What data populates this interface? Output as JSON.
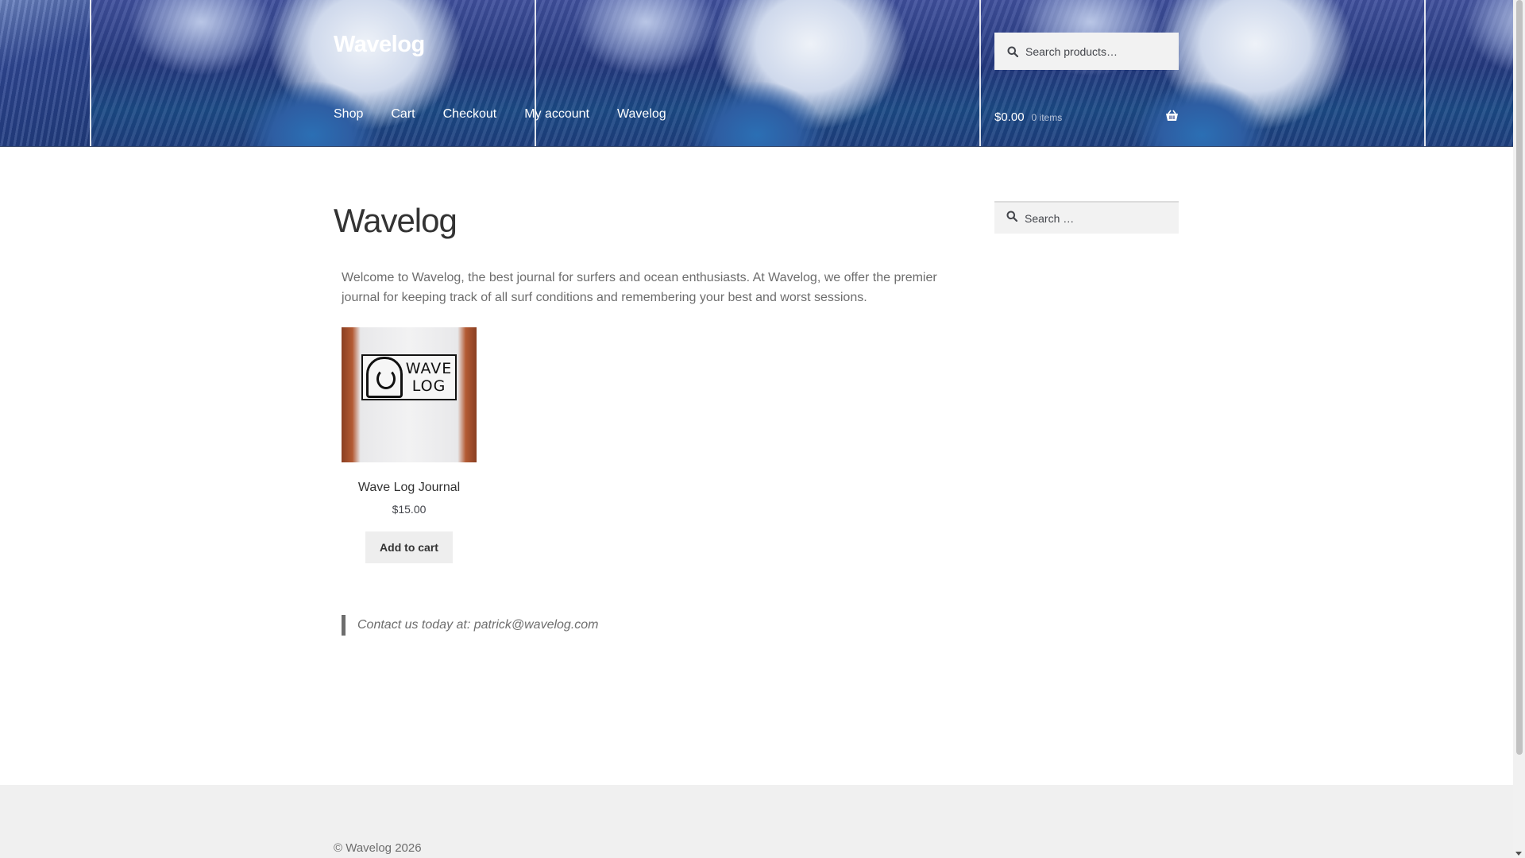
{
  "header": {
    "site_title": "Wavelog",
    "nav": [
      {
        "label": "Shop"
      },
      {
        "label": "Cart"
      },
      {
        "label": "Checkout"
      },
      {
        "label": "My account"
      },
      {
        "label": "Wavelog"
      }
    ],
    "search_placeholder": "Search products…",
    "cart_amount": "$0.00",
    "cart_count": "0 items"
  },
  "main": {
    "page_title": "Wavelog",
    "intro": "Welcome to Wavelog, the best journal for surfers and ocean enthusiasts. At Wavelog, we offer the premier journal for keeping track of all surf conditions and remembering  your best and worst sessions.",
    "product": {
      "image_text_line1": "WAVE",
      "image_text_line2": "LOG",
      "title": "Wave Log Journal",
      "price": "$15.00",
      "button_label": "Add to cart"
    },
    "contact": "Contact us today at: patrick@wavelog.com"
  },
  "sidebar": {
    "search_placeholder": "Search …"
  },
  "footer": {
    "copyright": "© Wavelog 2026"
  },
  "icons": {
    "search": "search-icon",
    "cart": "basket-icon"
  },
  "colors": {
    "header_text": "#ffffff",
    "heading": "#333333",
    "body_text": "#6d6d6d",
    "button_bg": "#eeeeee",
    "footer_bg": "#f0f0f0"
  }
}
